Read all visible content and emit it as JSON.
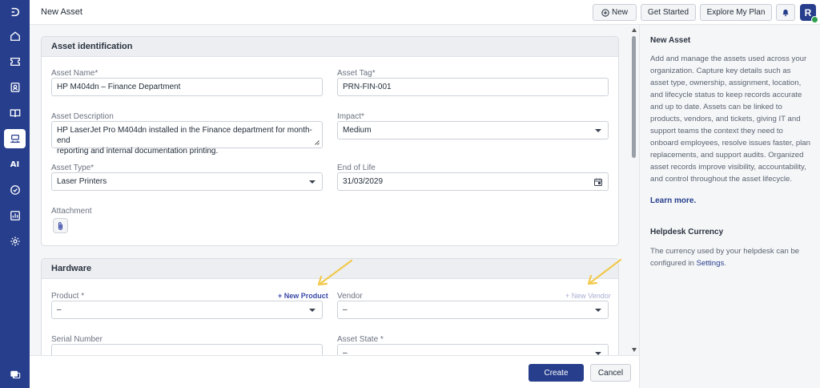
{
  "header": {
    "title": "New Asset",
    "new_label": "New",
    "get_started_label": "Get Started",
    "explore_label": "Explore My Plan",
    "avatar_initial": "R"
  },
  "sidebar": {
    "items": [
      {
        "name": "logo-icon"
      },
      {
        "name": "home-icon"
      },
      {
        "name": "tickets-icon"
      },
      {
        "name": "contacts-icon"
      },
      {
        "name": "knowledge-base-icon"
      },
      {
        "name": "assets-icon",
        "active": true
      },
      {
        "name": "ai-icon",
        "label": "AI"
      },
      {
        "name": "tasks-icon"
      },
      {
        "name": "reports-icon"
      },
      {
        "name": "settings-icon"
      },
      {
        "name": "chat-icon"
      }
    ]
  },
  "asset_identification": {
    "section_title": "Asset identification",
    "asset_name": {
      "label": "Asset Name*",
      "value": "HP M404dn – Finance Department"
    },
    "asset_tag": {
      "label": "Asset Tag*",
      "value": "PRN-FIN-001"
    },
    "asset_description": {
      "label": "Asset Description",
      "value_line1": "HP LaserJet Pro M404dn installed in the Finance department for month-end",
      "value_line2": "reporting and internal documentation printing."
    },
    "impact": {
      "label": "Impact*",
      "value": "Medium"
    },
    "asset_type": {
      "label": "Asset Type*",
      "value": "Laser Printers"
    },
    "end_of_life": {
      "label": "End of Life",
      "value": "31/03/2029"
    },
    "attachment": {
      "label": "Attachment"
    }
  },
  "hardware": {
    "section_title": "Hardware",
    "product": {
      "label": "Product *",
      "value": "–",
      "add_link": "+ New Product"
    },
    "vendor": {
      "label": "Vendor",
      "value": "–",
      "add_link": "+ New Vendor"
    },
    "serial_number": {
      "label": "Serial Number",
      "value": ""
    },
    "asset_state": {
      "label": "Asset State *",
      "value": "–"
    }
  },
  "footer": {
    "create_label": "Create",
    "cancel_label": "Cancel"
  },
  "help_panel": {
    "title": "New Asset",
    "description": "Add and manage the assets used across your organization. Capture key details such as asset type, ownership, assignment, location, and lifecycle status to keep records accurate and up to date. Assets can be linked to products, vendors, and tickets, giving IT and support teams the context they need to onboard employees, resolve issues faster, plan replacements, and support audits. Organized asset records improve visibility, accountability, and control throughout the asset lifecycle.",
    "learn_more": "Learn more.",
    "currency_title": "Helpdesk Currency",
    "currency_text": "The currency used by your helpdesk can be configured in",
    "currency_link": "Settings",
    "currency_end": "."
  },
  "colors": {
    "sidebar": "#263e8c",
    "primary": "#263e8c",
    "annotation_arrow": "#f2c94c"
  }
}
